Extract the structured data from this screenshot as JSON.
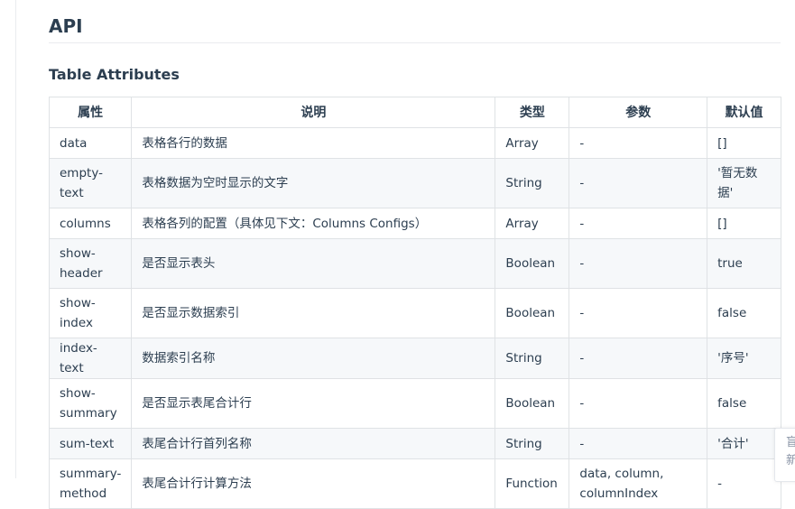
{
  "page": {
    "title": "API",
    "section_title": "Table Attributes"
  },
  "table": {
    "headers": [
      "属性",
      "说明",
      "类型",
      "参数",
      "默认值"
    ],
    "rows": [
      {
        "attr": "data",
        "desc": "表格各行的数据",
        "type": "Array",
        "param": "-",
        "default": "[]"
      },
      {
        "attr": "empty-text",
        "desc": "表格数据为空时显示的文字",
        "type": "String",
        "param": "-",
        "default": "'暂无数据'"
      },
      {
        "attr": "columns",
        "desc": "表格各列的配置（具体见下文：Columns Configs）",
        "type": "Array",
        "param": "-",
        "default": "[]"
      },
      {
        "attr": "show-header",
        "desc": "是否显示表头",
        "type": "Boolean",
        "param": "-",
        "default": "true"
      },
      {
        "attr": "show-index",
        "desc": "是否显示数据索引",
        "type": "Boolean",
        "param": "-",
        "default": "false"
      },
      {
        "attr": "index-text",
        "desc": "数据索引名称",
        "type": "String",
        "param": "-",
        "default": "'序号'"
      },
      {
        "attr": "show-summary",
        "desc": "是否显示表尾合计行",
        "type": "Boolean",
        "param": "-",
        "default": "false"
      },
      {
        "attr": "sum-text",
        "desc": "表尾合计行首列名称",
        "type": "String",
        "param": "-",
        "default": "'合计'"
      },
      {
        "attr": "summary-method",
        "desc": "表尾合计行计算方法",
        "type": "Function",
        "param": "data, column, columnIndex",
        "default": "-"
      }
    ]
  },
  "side_widget": {
    "line1": "盲",
    "line2": "新"
  },
  "colors": {
    "text": "#2c3e50",
    "border": "#dfe2e5",
    "row_stripe": "#f6f8fa"
  }
}
